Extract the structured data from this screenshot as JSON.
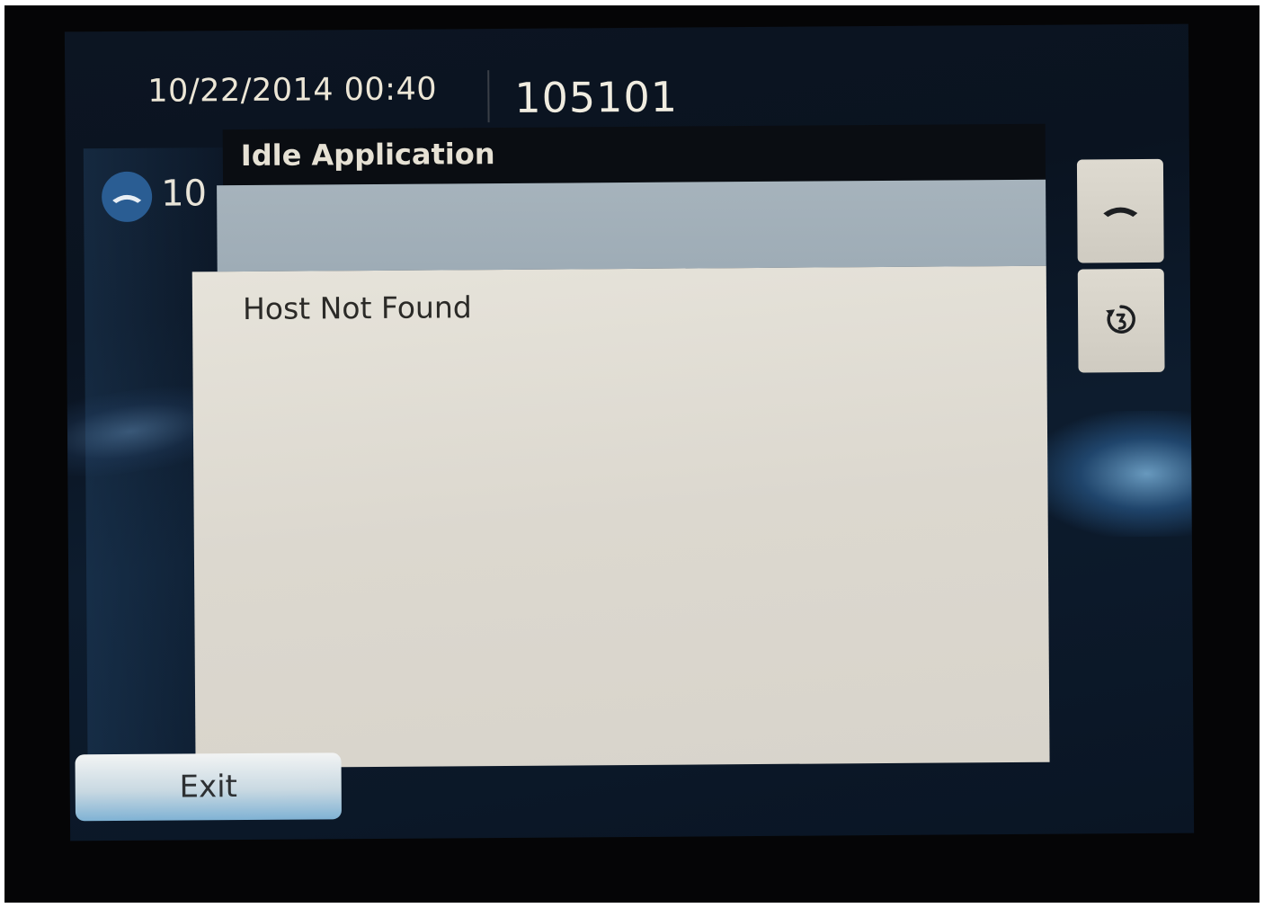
{
  "status_bar": {
    "datetime": "10/22/2014 00:40",
    "extension": "105101"
  },
  "line_key": {
    "icon": "handset-icon",
    "label": "10"
  },
  "dialog": {
    "title": "Idle Application",
    "message": "Host Not Found"
  },
  "side_buttons": [
    {
      "icon": "handset-icon"
    },
    {
      "icon": "redial-icon"
    }
  ],
  "softkeys": {
    "exit_label": "Exit"
  },
  "colors": {
    "screen_background": "#0c1522",
    "line_icon": "#2a5d93",
    "dialog_titlebar": "#0a0d12",
    "dialog_highlight": "#a6b3bc",
    "dialog_body": "#e0ddd4",
    "exit_button_accent": "#7fb2d4"
  }
}
